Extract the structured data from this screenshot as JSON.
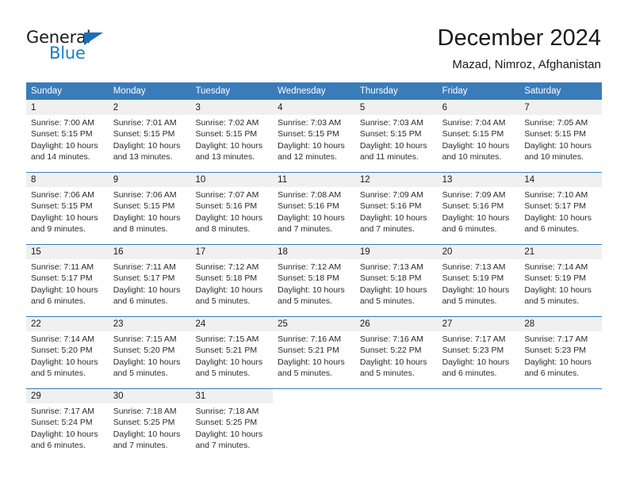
{
  "brand": {
    "name_top": "General",
    "name_bottom": "Blue",
    "accent_color": "#1d7dc4",
    "triangle_color": "#1d6fb5"
  },
  "header": {
    "title": "December 2024",
    "subtitle": "Mazad, Nimroz, Afghanistan"
  },
  "theme": {
    "header_row_color": "#3a7cba",
    "daynum_bg": "#f0f0f0",
    "page_bg": "#ffffff",
    "text_color": "#1a1a1a"
  },
  "weekdays": [
    "Sunday",
    "Monday",
    "Tuesday",
    "Wednesday",
    "Thursday",
    "Friday",
    "Saturday"
  ],
  "weeks": [
    [
      {
        "day": "1",
        "sunrise": "Sunrise: 7:00 AM",
        "sunset": "Sunset: 5:15 PM",
        "daylight1": "Daylight: 10 hours",
        "daylight2": "and 14 minutes."
      },
      {
        "day": "2",
        "sunrise": "Sunrise: 7:01 AM",
        "sunset": "Sunset: 5:15 PM",
        "daylight1": "Daylight: 10 hours",
        "daylight2": "and 13 minutes."
      },
      {
        "day": "3",
        "sunrise": "Sunrise: 7:02 AM",
        "sunset": "Sunset: 5:15 PM",
        "daylight1": "Daylight: 10 hours",
        "daylight2": "and 13 minutes."
      },
      {
        "day": "4",
        "sunrise": "Sunrise: 7:03 AM",
        "sunset": "Sunset: 5:15 PM",
        "daylight1": "Daylight: 10 hours",
        "daylight2": "and 12 minutes."
      },
      {
        "day": "5",
        "sunrise": "Sunrise: 7:03 AM",
        "sunset": "Sunset: 5:15 PM",
        "daylight1": "Daylight: 10 hours",
        "daylight2": "and 11 minutes."
      },
      {
        "day": "6",
        "sunrise": "Sunrise: 7:04 AM",
        "sunset": "Sunset: 5:15 PM",
        "daylight1": "Daylight: 10 hours",
        "daylight2": "and 10 minutes."
      },
      {
        "day": "7",
        "sunrise": "Sunrise: 7:05 AM",
        "sunset": "Sunset: 5:15 PM",
        "daylight1": "Daylight: 10 hours",
        "daylight2": "and 10 minutes."
      }
    ],
    [
      {
        "day": "8",
        "sunrise": "Sunrise: 7:06 AM",
        "sunset": "Sunset: 5:15 PM",
        "daylight1": "Daylight: 10 hours",
        "daylight2": "and 9 minutes."
      },
      {
        "day": "9",
        "sunrise": "Sunrise: 7:06 AM",
        "sunset": "Sunset: 5:15 PM",
        "daylight1": "Daylight: 10 hours",
        "daylight2": "and 8 minutes."
      },
      {
        "day": "10",
        "sunrise": "Sunrise: 7:07 AM",
        "sunset": "Sunset: 5:16 PM",
        "daylight1": "Daylight: 10 hours",
        "daylight2": "and 8 minutes."
      },
      {
        "day": "11",
        "sunrise": "Sunrise: 7:08 AM",
        "sunset": "Sunset: 5:16 PM",
        "daylight1": "Daylight: 10 hours",
        "daylight2": "and 7 minutes."
      },
      {
        "day": "12",
        "sunrise": "Sunrise: 7:09 AM",
        "sunset": "Sunset: 5:16 PM",
        "daylight1": "Daylight: 10 hours",
        "daylight2": "and 7 minutes."
      },
      {
        "day": "13",
        "sunrise": "Sunrise: 7:09 AM",
        "sunset": "Sunset: 5:16 PM",
        "daylight1": "Daylight: 10 hours",
        "daylight2": "and 6 minutes."
      },
      {
        "day": "14",
        "sunrise": "Sunrise: 7:10 AM",
        "sunset": "Sunset: 5:17 PM",
        "daylight1": "Daylight: 10 hours",
        "daylight2": "and 6 minutes."
      }
    ],
    [
      {
        "day": "15",
        "sunrise": "Sunrise: 7:11 AM",
        "sunset": "Sunset: 5:17 PM",
        "daylight1": "Daylight: 10 hours",
        "daylight2": "and 6 minutes."
      },
      {
        "day": "16",
        "sunrise": "Sunrise: 7:11 AM",
        "sunset": "Sunset: 5:17 PM",
        "daylight1": "Daylight: 10 hours",
        "daylight2": "and 6 minutes."
      },
      {
        "day": "17",
        "sunrise": "Sunrise: 7:12 AM",
        "sunset": "Sunset: 5:18 PM",
        "daylight1": "Daylight: 10 hours",
        "daylight2": "and 5 minutes."
      },
      {
        "day": "18",
        "sunrise": "Sunrise: 7:12 AM",
        "sunset": "Sunset: 5:18 PM",
        "daylight1": "Daylight: 10 hours",
        "daylight2": "and 5 minutes."
      },
      {
        "day": "19",
        "sunrise": "Sunrise: 7:13 AM",
        "sunset": "Sunset: 5:18 PM",
        "daylight1": "Daylight: 10 hours",
        "daylight2": "and 5 minutes."
      },
      {
        "day": "20",
        "sunrise": "Sunrise: 7:13 AM",
        "sunset": "Sunset: 5:19 PM",
        "daylight1": "Daylight: 10 hours",
        "daylight2": "and 5 minutes."
      },
      {
        "day": "21",
        "sunrise": "Sunrise: 7:14 AM",
        "sunset": "Sunset: 5:19 PM",
        "daylight1": "Daylight: 10 hours",
        "daylight2": "and 5 minutes."
      }
    ],
    [
      {
        "day": "22",
        "sunrise": "Sunrise: 7:14 AM",
        "sunset": "Sunset: 5:20 PM",
        "daylight1": "Daylight: 10 hours",
        "daylight2": "and 5 minutes."
      },
      {
        "day": "23",
        "sunrise": "Sunrise: 7:15 AM",
        "sunset": "Sunset: 5:20 PM",
        "daylight1": "Daylight: 10 hours",
        "daylight2": "and 5 minutes."
      },
      {
        "day": "24",
        "sunrise": "Sunrise: 7:15 AM",
        "sunset": "Sunset: 5:21 PM",
        "daylight1": "Daylight: 10 hours",
        "daylight2": "and 5 minutes."
      },
      {
        "day": "25",
        "sunrise": "Sunrise: 7:16 AM",
        "sunset": "Sunset: 5:21 PM",
        "daylight1": "Daylight: 10 hours",
        "daylight2": "and 5 minutes."
      },
      {
        "day": "26",
        "sunrise": "Sunrise: 7:16 AM",
        "sunset": "Sunset: 5:22 PM",
        "daylight1": "Daylight: 10 hours",
        "daylight2": "and 5 minutes."
      },
      {
        "day": "27",
        "sunrise": "Sunrise: 7:17 AM",
        "sunset": "Sunset: 5:23 PM",
        "daylight1": "Daylight: 10 hours",
        "daylight2": "and 6 minutes."
      },
      {
        "day": "28",
        "sunrise": "Sunrise: 7:17 AM",
        "sunset": "Sunset: 5:23 PM",
        "daylight1": "Daylight: 10 hours",
        "daylight2": "and 6 minutes."
      }
    ],
    [
      {
        "day": "29",
        "sunrise": "Sunrise: 7:17 AM",
        "sunset": "Sunset: 5:24 PM",
        "daylight1": "Daylight: 10 hours",
        "daylight2": "and 6 minutes."
      },
      {
        "day": "30",
        "sunrise": "Sunrise: 7:18 AM",
        "sunset": "Sunset: 5:25 PM",
        "daylight1": "Daylight: 10 hours",
        "daylight2": "and 7 minutes."
      },
      {
        "day": "31",
        "sunrise": "Sunrise: 7:18 AM",
        "sunset": "Sunset: 5:25 PM",
        "daylight1": "Daylight: 10 hours",
        "daylight2": "and 7 minutes."
      },
      {
        "day": "",
        "sunrise": "",
        "sunset": "",
        "daylight1": "",
        "daylight2": ""
      },
      {
        "day": "",
        "sunrise": "",
        "sunset": "",
        "daylight1": "",
        "daylight2": ""
      },
      {
        "day": "",
        "sunrise": "",
        "sunset": "",
        "daylight1": "",
        "daylight2": ""
      },
      {
        "day": "",
        "sunrise": "",
        "sunset": "",
        "daylight1": "",
        "daylight2": ""
      }
    ]
  ]
}
